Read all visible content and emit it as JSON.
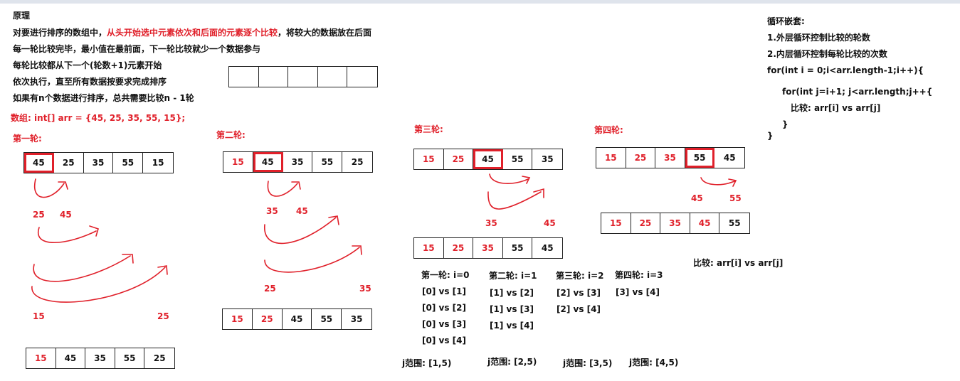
{
  "left_text": {
    "title": "原理",
    "line1_pre": "对要进行排序的数组中，",
    "line1_red": "从头开始选中元素依次和后面的元素逐个比较",
    "line1_post": "，将较大的数据放在后面",
    "line2": "每一轮比较完毕，最小值在最前面，下一轮比较就少一个数据参与",
    "line3": "每轮比较都从下一个(轮数+1)元素开始",
    "line4": "依次执行，直至所有数据按要求完成排序",
    "line5": "如果有n个数据进行排序，总共需要比较n - 1轮",
    "array_decl": "数组: int[] arr = {45, 25, 35, 55, 15};"
  },
  "rounds": [
    {
      "title": "第一轮:",
      "initial": [
        "45",
        "25",
        "35",
        "55",
        "15"
      ],
      "result": [
        "15",
        "45",
        "35",
        "55",
        "25"
      ],
      "labels": [
        "25",
        "45",
        "15",
        "25"
      ]
    },
    {
      "title": "第二轮:",
      "initial": [
        "15",
        "45",
        "35",
        "55",
        "25"
      ],
      "result": [
        "15",
        "25",
        "45",
        "55",
        "35"
      ],
      "labels": [
        "35",
        "45",
        "25",
        "35"
      ]
    },
    {
      "title": "第三轮:",
      "initial": [
        "15",
        "25",
        "45",
        "55",
        "35"
      ],
      "result": [
        "15",
        "25",
        "35",
        "55",
        "45"
      ],
      "labels": [
        "35",
        "45"
      ]
    },
    {
      "title": "第四轮:",
      "initial": [
        "15",
        "25",
        "35",
        "55",
        "45"
      ],
      "result": [
        "15",
        "25",
        "35",
        "45",
        "55"
      ],
      "labels": [
        "45",
        "55"
      ]
    }
  ],
  "comparisons": [
    {
      "header": "第一轮: i=0",
      "items": [
        "[0] vs [1]",
        "[0] vs [2]",
        "[0] vs [3]",
        "[0] vs [4]"
      ],
      "j_range": "j范围: [1,5)"
    },
    {
      "header": "第二轮: i=1",
      "items": [
        "[1] vs [2]",
        "[1] vs [3]",
        "[1] vs [4]"
      ],
      "j_range": "j范围: [2,5)"
    },
    {
      "header": "第三轮: i=2",
      "items": [
        "[2] vs [3]",
        "[2] vs [4]"
      ],
      "j_range": "j范围: [3,5)"
    },
    {
      "header": "第四轮: i=3",
      "items": [
        "[3] vs [4]"
      ],
      "j_range": "j范围: [4,5)"
    }
  ],
  "compare_note": "比较: arr[i] vs arr[j]",
  "loop_notes": {
    "title": "循环嵌套:",
    "outer": "1.外层循环控制比较的轮数",
    "inner": "2.内层循环控制每轮比较的次数",
    "for_outer": "for(int i = 0;i<arr.length-1;i++){",
    "for_inner": "for(int j=i+1; j<arr.length;j++{",
    "compare": "比较:  arr[i]  vs  arr[j]",
    "close_inner": "}",
    "close_outer": "}"
  },
  "colors": {
    "accent": "#e0202a",
    "border": "#222222",
    "topbar": "#dfe4ec"
  }
}
